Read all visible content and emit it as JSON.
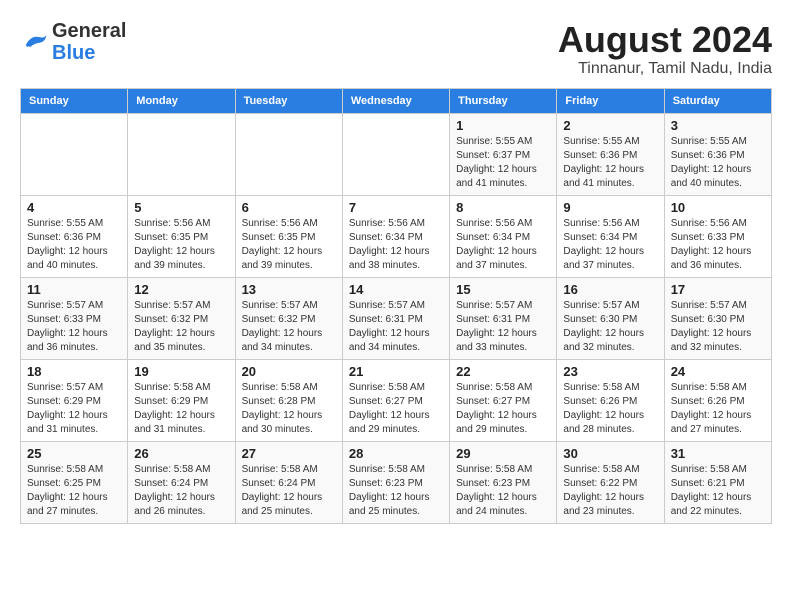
{
  "header": {
    "logo_line1": "General",
    "logo_line2": "Blue",
    "title": "August 2024",
    "subtitle": "Tinnanur, Tamil Nadu, India"
  },
  "days_of_week": [
    "Sunday",
    "Monday",
    "Tuesday",
    "Wednesday",
    "Thursday",
    "Friday",
    "Saturday"
  ],
  "weeks": [
    [
      {
        "day": "",
        "detail": ""
      },
      {
        "day": "",
        "detail": ""
      },
      {
        "day": "",
        "detail": ""
      },
      {
        "day": "",
        "detail": ""
      },
      {
        "day": "1",
        "detail": "Sunrise: 5:55 AM\nSunset: 6:37 PM\nDaylight: 12 hours\nand 41 minutes."
      },
      {
        "day": "2",
        "detail": "Sunrise: 5:55 AM\nSunset: 6:36 PM\nDaylight: 12 hours\nand 41 minutes."
      },
      {
        "day": "3",
        "detail": "Sunrise: 5:55 AM\nSunset: 6:36 PM\nDaylight: 12 hours\nand 40 minutes."
      }
    ],
    [
      {
        "day": "4",
        "detail": "Sunrise: 5:55 AM\nSunset: 6:36 PM\nDaylight: 12 hours\nand 40 minutes."
      },
      {
        "day": "5",
        "detail": "Sunrise: 5:56 AM\nSunset: 6:35 PM\nDaylight: 12 hours\nand 39 minutes."
      },
      {
        "day": "6",
        "detail": "Sunrise: 5:56 AM\nSunset: 6:35 PM\nDaylight: 12 hours\nand 39 minutes."
      },
      {
        "day": "7",
        "detail": "Sunrise: 5:56 AM\nSunset: 6:34 PM\nDaylight: 12 hours\nand 38 minutes."
      },
      {
        "day": "8",
        "detail": "Sunrise: 5:56 AM\nSunset: 6:34 PM\nDaylight: 12 hours\nand 37 minutes."
      },
      {
        "day": "9",
        "detail": "Sunrise: 5:56 AM\nSunset: 6:34 PM\nDaylight: 12 hours\nand 37 minutes."
      },
      {
        "day": "10",
        "detail": "Sunrise: 5:56 AM\nSunset: 6:33 PM\nDaylight: 12 hours\nand 36 minutes."
      }
    ],
    [
      {
        "day": "11",
        "detail": "Sunrise: 5:57 AM\nSunset: 6:33 PM\nDaylight: 12 hours\nand 36 minutes."
      },
      {
        "day": "12",
        "detail": "Sunrise: 5:57 AM\nSunset: 6:32 PM\nDaylight: 12 hours\nand 35 minutes."
      },
      {
        "day": "13",
        "detail": "Sunrise: 5:57 AM\nSunset: 6:32 PM\nDaylight: 12 hours\nand 34 minutes."
      },
      {
        "day": "14",
        "detail": "Sunrise: 5:57 AM\nSunset: 6:31 PM\nDaylight: 12 hours\nand 34 minutes."
      },
      {
        "day": "15",
        "detail": "Sunrise: 5:57 AM\nSunset: 6:31 PM\nDaylight: 12 hours\nand 33 minutes."
      },
      {
        "day": "16",
        "detail": "Sunrise: 5:57 AM\nSunset: 6:30 PM\nDaylight: 12 hours\nand 32 minutes."
      },
      {
        "day": "17",
        "detail": "Sunrise: 5:57 AM\nSunset: 6:30 PM\nDaylight: 12 hours\nand 32 minutes."
      }
    ],
    [
      {
        "day": "18",
        "detail": "Sunrise: 5:57 AM\nSunset: 6:29 PM\nDaylight: 12 hours\nand 31 minutes."
      },
      {
        "day": "19",
        "detail": "Sunrise: 5:58 AM\nSunset: 6:29 PM\nDaylight: 12 hours\nand 31 minutes."
      },
      {
        "day": "20",
        "detail": "Sunrise: 5:58 AM\nSunset: 6:28 PM\nDaylight: 12 hours\nand 30 minutes."
      },
      {
        "day": "21",
        "detail": "Sunrise: 5:58 AM\nSunset: 6:27 PM\nDaylight: 12 hours\nand 29 minutes."
      },
      {
        "day": "22",
        "detail": "Sunrise: 5:58 AM\nSunset: 6:27 PM\nDaylight: 12 hours\nand 29 minutes."
      },
      {
        "day": "23",
        "detail": "Sunrise: 5:58 AM\nSunset: 6:26 PM\nDaylight: 12 hours\nand 28 minutes."
      },
      {
        "day": "24",
        "detail": "Sunrise: 5:58 AM\nSunset: 6:26 PM\nDaylight: 12 hours\nand 27 minutes."
      }
    ],
    [
      {
        "day": "25",
        "detail": "Sunrise: 5:58 AM\nSunset: 6:25 PM\nDaylight: 12 hours\nand 27 minutes."
      },
      {
        "day": "26",
        "detail": "Sunrise: 5:58 AM\nSunset: 6:24 PM\nDaylight: 12 hours\nand 26 minutes."
      },
      {
        "day": "27",
        "detail": "Sunrise: 5:58 AM\nSunset: 6:24 PM\nDaylight: 12 hours\nand 25 minutes."
      },
      {
        "day": "28",
        "detail": "Sunrise: 5:58 AM\nSunset: 6:23 PM\nDaylight: 12 hours\nand 25 minutes."
      },
      {
        "day": "29",
        "detail": "Sunrise: 5:58 AM\nSunset: 6:23 PM\nDaylight: 12 hours\nand 24 minutes."
      },
      {
        "day": "30",
        "detail": "Sunrise: 5:58 AM\nSunset: 6:22 PM\nDaylight: 12 hours\nand 23 minutes."
      },
      {
        "day": "31",
        "detail": "Sunrise: 5:58 AM\nSunset: 6:21 PM\nDaylight: 12 hours\nand 22 minutes."
      }
    ]
  ]
}
